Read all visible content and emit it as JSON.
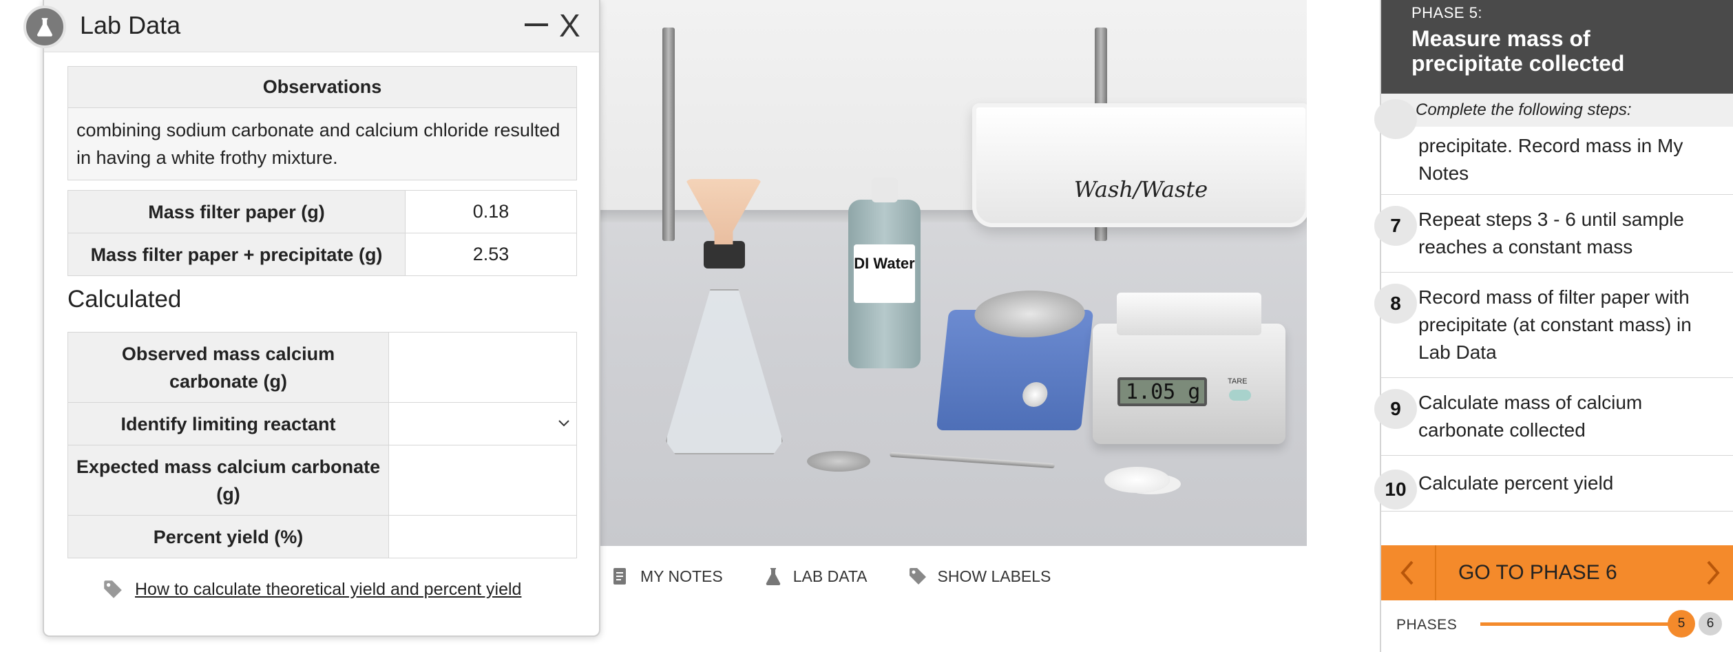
{
  "lab_data": {
    "title": "Lab Data",
    "observations_header": "Observations",
    "observations_text": "combining sodium carbonate and calcium chloride resulted in having a white frothy mixture.",
    "measured": [
      {
        "label": "Mass filter paper (g)",
        "value": "0.18"
      },
      {
        "label": "Mass filter paper + precipitate (g)",
        "value": "2.53"
      }
    ],
    "calculated_heading": "Calculated",
    "calculated": [
      {
        "label": "Observed mass calcium carbonate (g)",
        "value": ""
      },
      {
        "label": "Identify limiting reactant",
        "value": ""
      },
      {
        "label": "Expected mass calcium carbonate (g)",
        "value": ""
      },
      {
        "label": "Percent yield (%)",
        "value": ""
      }
    ],
    "help_link": "How to calculate theoretical yield and percent yield"
  },
  "scene": {
    "sink_label": "Wash/Waste",
    "bottle_label": "DI Water",
    "balance_reading": "1.05 g",
    "tare_label": "TARE"
  },
  "toolbar": {
    "my_notes": "MY NOTES",
    "lab_data": "LAB DATA",
    "show_labels": "SHOW LABELS"
  },
  "procedure": {
    "phase_label": "PHASE 5:",
    "phase_title": "Measure mass of precipitate collected",
    "subtitle": "Complete the following steps:",
    "steps": [
      {
        "num": "",
        "text": "precipitate. Record mass in My Notes"
      },
      {
        "num": "7",
        "text": "Repeat steps 3 - 6 until sample reaches a constant mass"
      },
      {
        "num": "8",
        "text": "Record mass of filter paper with precipitate (at constant mass) in Lab Data"
      },
      {
        "num": "9",
        "text": "Calculate mass of calcium carbonate collected"
      },
      {
        "num": "10",
        "text": "Calculate percent yield"
      }
    ],
    "next_button": "GO TO PHASE 6",
    "phases_label": "PHASES",
    "current_phase": "5",
    "next_phase": "6"
  },
  "colors": {
    "accent": "#f48a2b",
    "header_dark": "#4a4a4a"
  }
}
